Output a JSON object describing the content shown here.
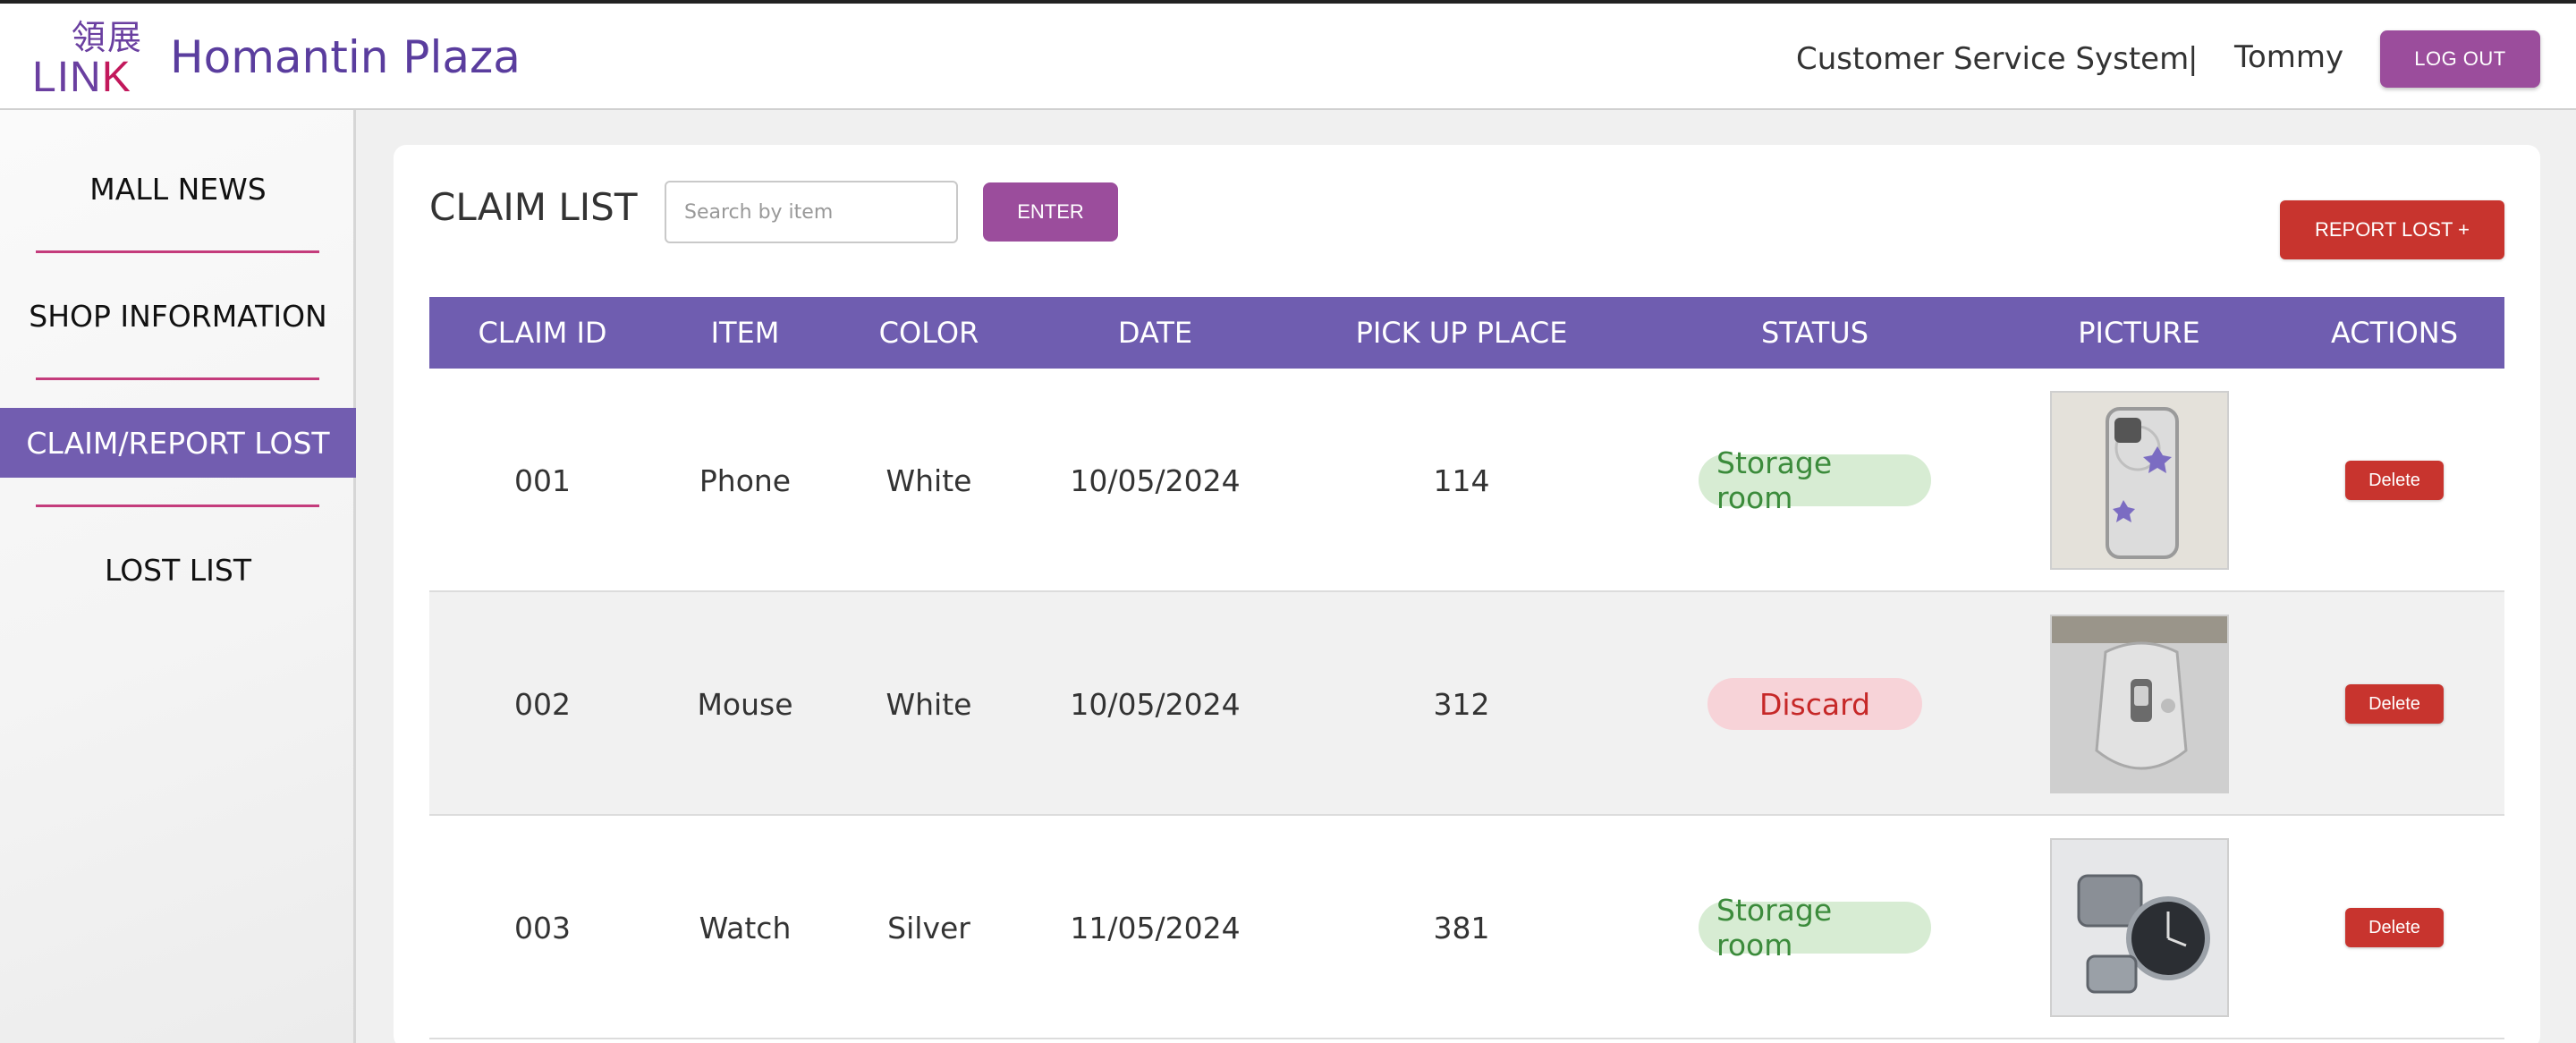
{
  "header": {
    "logo_cjk": "領展",
    "logo_word_a": "LIN",
    "logo_word_b": "K",
    "mall_name": "Homantin Plaza",
    "system_title": "Customer Service System",
    "separator": "|",
    "user_name": "Tommy",
    "logout_label": "LOG OUT"
  },
  "sidebar": {
    "items": [
      {
        "label": "MALL NEWS",
        "active": false
      },
      {
        "label": "SHOP INFORMATION",
        "active": false
      },
      {
        "label": "CLAIM/REPORT LOST",
        "active": true
      },
      {
        "label": "LOST LIST",
        "active": false
      }
    ],
    "active_color": "#725db0",
    "separator_color": "#c43c7c"
  },
  "main": {
    "title": "CLAIM LIST",
    "search": {
      "placeholder": "Search by item",
      "value": ""
    },
    "enter_label": "ENTER",
    "report_label": "REPORT LOST +",
    "table": {
      "headers": [
        "CLAIM ID",
        "ITEM",
        "COLOR",
        "DATE",
        "PICK UP PLACE",
        "STATUS",
        "PICTURE",
        "ACTIONS"
      ],
      "rows": [
        {
          "id": "001",
          "item": "Phone",
          "color": "White",
          "date": "10/05/2024",
          "place": "114",
          "status": "Storage room",
          "status_type": "storage",
          "picture": "phone-photo",
          "action": "Delete"
        },
        {
          "id": "002",
          "item": "Mouse",
          "color": "White",
          "date": "10/05/2024",
          "place": "312",
          "status": "Discard",
          "status_type": "discard",
          "picture": "mouse-photo",
          "action": "Delete"
        },
        {
          "id": "003",
          "item": "Watch",
          "color": "Silver",
          "date": "11/05/2024",
          "place": "381",
          "status": "Storage room",
          "status_type": "storage",
          "picture": "watch-photo",
          "action": "Delete"
        }
      ]
    }
  },
  "colors": {
    "brand_purple": "#5a3d9e",
    "button_purple": "#9b4d9c",
    "table_header": "#6f5db0",
    "danger": "#c8342e",
    "storage_bg": "#d7ecd3",
    "storage_fg": "#3b8b3b",
    "discard_bg": "#f7d3d8",
    "discard_fg": "#c62828"
  }
}
